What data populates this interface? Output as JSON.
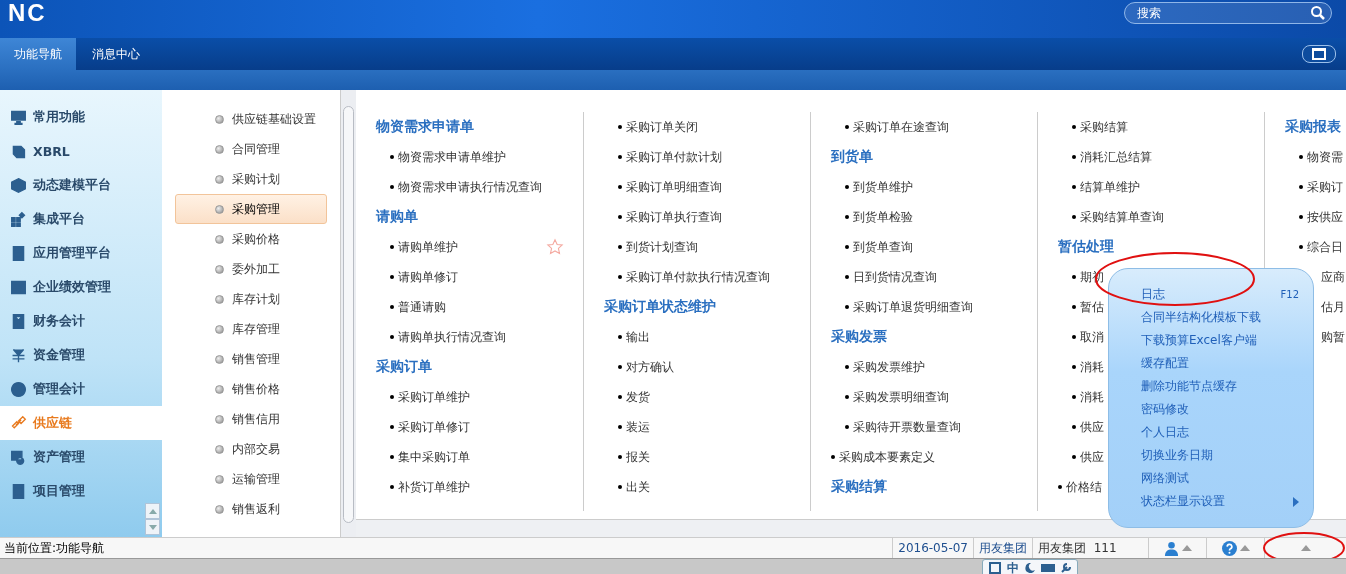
{
  "header": {
    "logo": "NC",
    "search": {
      "placeholder": "搜索"
    }
  },
  "tabs": [
    {
      "label": "功能导航",
      "selected": true
    },
    {
      "label": "消息中心",
      "selected": false
    }
  ],
  "nav": [
    {
      "label": "常用功能",
      "selected": false
    },
    {
      "label": "XBRL",
      "selected": false
    },
    {
      "label": "动态建模平台",
      "selected": false
    },
    {
      "label": "集成平台",
      "selected": false
    },
    {
      "label": "应用管理平台",
      "selected": false
    },
    {
      "label": "企业绩效管理",
      "selected": false
    },
    {
      "label": "财务会计",
      "selected": false
    },
    {
      "label": "资金管理",
      "selected": false
    },
    {
      "label": "管理会计",
      "selected": false
    },
    {
      "label": "供应链",
      "selected": true
    },
    {
      "label": "资产管理",
      "selected": false
    },
    {
      "label": "项目管理",
      "selected": false
    }
  ],
  "subnav": [
    {
      "label": "供应链基础设置",
      "selected": false
    },
    {
      "label": "合同管理",
      "selected": false
    },
    {
      "label": "采购计划",
      "selected": false
    },
    {
      "label": "采购管理",
      "selected": true
    },
    {
      "label": "采购价格",
      "selected": false
    },
    {
      "label": "委外加工",
      "selected": false
    },
    {
      "label": "库存计划",
      "selected": false
    },
    {
      "label": "库存管理",
      "selected": false
    },
    {
      "label": "销售管理",
      "selected": false
    },
    {
      "label": "销售价格",
      "selected": false
    },
    {
      "label": "销售信用",
      "selected": false
    },
    {
      "label": "内部交易",
      "selected": false
    },
    {
      "label": "运输管理",
      "selected": false
    },
    {
      "label": "销售返利",
      "selected": false
    }
  ],
  "columns": [
    [
      {
        "kind": "heading",
        "text": "物资需求申请单"
      },
      {
        "kind": "item",
        "text": "物资需求申请单维护"
      },
      {
        "kind": "item",
        "text": "物资需求申请执行情况查询"
      },
      {
        "kind": "heading",
        "text": "请购单"
      },
      {
        "kind": "item",
        "text": "请购单维护",
        "starred": true
      },
      {
        "kind": "item",
        "text": "请购单修订"
      },
      {
        "kind": "item",
        "text": "普通请购"
      },
      {
        "kind": "item",
        "text": "请购单执行情况查询"
      },
      {
        "kind": "heading",
        "text": "采购订单"
      },
      {
        "kind": "item",
        "text": "采购订单维护"
      },
      {
        "kind": "item",
        "text": "采购订单修订"
      },
      {
        "kind": "item",
        "text": "集中采购订单"
      },
      {
        "kind": "item",
        "text": "补货订单维护"
      }
    ],
    [
      {
        "kind": "item",
        "text": "采购订单关闭"
      },
      {
        "kind": "item",
        "text": "采购订单付款计划"
      },
      {
        "kind": "item",
        "text": "采购订单明细查询"
      },
      {
        "kind": "item",
        "text": "采购订单执行查询"
      },
      {
        "kind": "item",
        "text": "到货计划查询"
      },
      {
        "kind": "item",
        "text": "采购订单付款执行情况查询"
      },
      {
        "kind": "heading",
        "text": "采购订单状态维护"
      },
      {
        "kind": "item",
        "text": "输出"
      },
      {
        "kind": "item",
        "text": "对方确认"
      },
      {
        "kind": "item",
        "text": "发货"
      },
      {
        "kind": "item",
        "text": "装运"
      },
      {
        "kind": "item",
        "text": "报关"
      },
      {
        "kind": "item",
        "text": "出关"
      }
    ],
    [
      {
        "kind": "item",
        "text": "采购订单在途查询"
      },
      {
        "kind": "heading",
        "text": "到货单"
      },
      {
        "kind": "item",
        "text": "到货单维护"
      },
      {
        "kind": "item",
        "text": "到货单检验"
      },
      {
        "kind": "item",
        "text": "到货单查询"
      },
      {
        "kind": "item",
        "text": "日到货情况查询"
      },
      {
        "kind": "item",
        "text": "采购订单退货明细查询"
      },
      {
        "kind": "heading",
        "text": "采购发票"
      },
      {
        "kind": "item",
        "text": "采购发票维护"
      },
      {
        "kind": "item",
        "text": "采购发票明细查询"
      },
      {
        "kind": "item",
        "text": "采购待开票数量查询"
      },
      {
        "kind": "outdented",
        "text": "采购成本要素定义"
      },
      {
        "kind": "heading",
        "text": "采购结算"
      }
    ],
    [
      {
        "kind": "item",
        "text": "采购结算"
      },
      {
        "kind": "item",
        "text": "消耗汇总结算"
      },
      {
        "kind": "item",
        "text": "结算单维护"
      },
      {
        "kind": "item",
        "text": "采购结算单查询"
      },
      {
        "kind": "heading",
        "text": "暂估处理"
      },
      {
        "kind": "item",
        "text": "期初"
      },
      {
        "kind": "item",
        "text": "暂估"
      },
      {
        "kind": "item",
        "text": "取消"
      },
      {
        "kind": "item",
        "text": "消耗"
      },
      {
        "kind": "item",
        "text": "消耗"
      },
      {
        "kind": "item",
        "text": "供应"
      },
      {
        "kind": "item",
        "text": "供应"
      },
      {
        "kind": "outdented",
        "text": "价格结"
      }
    ],
    [
      {
        "kind": "heading",
        "text": "采购报表"
      },
      {
        "kind": "item",
        "text": "物资需"
      },
      {
        "kind": "item",
        "text": "采购订"
      },
      {
        "kind": "item",
        "text": "按供应"
      },
      {
        "kind": "item",
        "text": "综合日"
      },
      {
        "kind": "tail",
        "text": "应商"
      },
      {
        "kind": "tail",
        "text": "估月"
      },
      {
        "kind": "tail",
        "text": "购暂"
      }
    ]
  ],
  "popup_menu": [
    {
      "label": "日志",
      "shortcut": "F12",
      "highlighted": true
    },
    {
      "label": "合同半结构化模板下载"
    },
    {
      "label": "下载预算Excel客户端"
    },
    {
      "label": "缓存配置"
    },
    {
      "label": "删除功能节点缓存"
    },
    {
      "label": "密码修改"
    },
    {
      "label": "个人日志"
    },
    {
      "label": "切换业务日期"
    },
    {
      "label": "网络测试"
    },
    {
      "label": "状态栏显示设置",
      "has_submenu": true
    }
  ],
  "status_bar": {
    "location": "当前位置:功能导航",
    "date": "2016-05-07",
    "group": "用友集团",
    "user": "用友集团  111",
    "menu_highlighted": true
  },
  "ime_bar": {
    "mode": "中"
  }
}
